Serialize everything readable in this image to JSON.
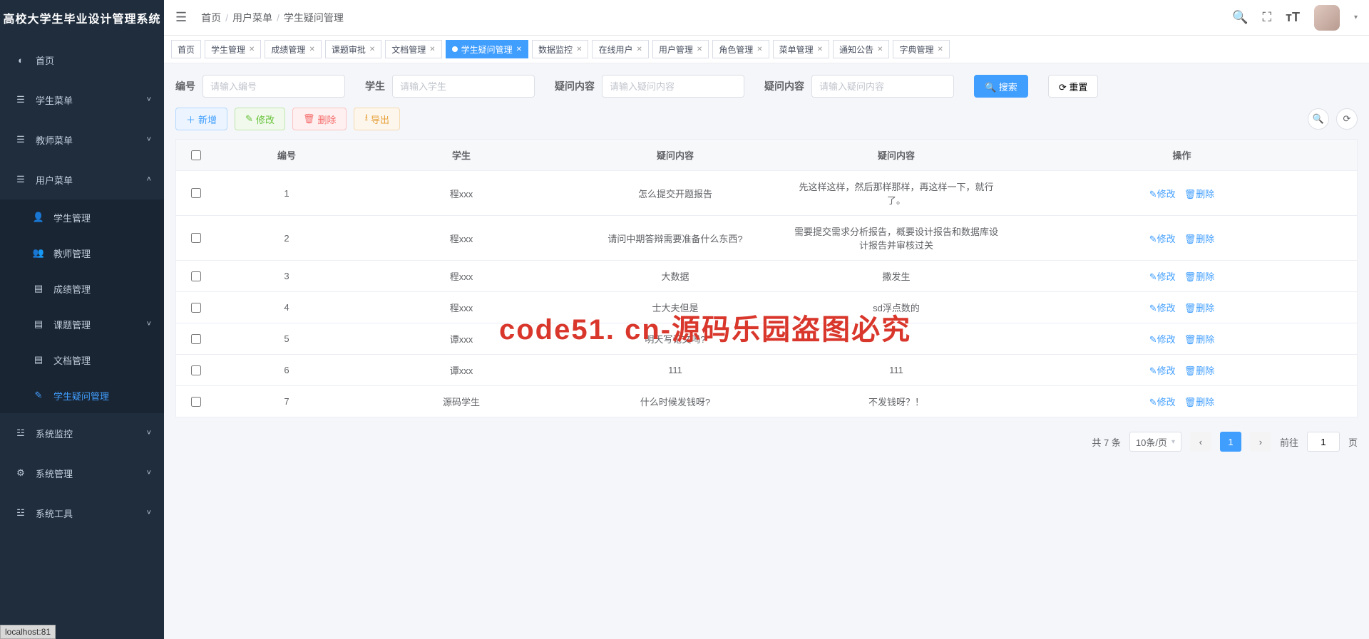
{
  "app_title": "高校大学生毕业设计管理系统",
  "breadcrumb": [
    "首页",
    "用户菜单",
    "学生疑问管理"
  ],
  "header_icons": {
    "search": "search-icon",
    "fullscreen": "fullscreen-icon",
    "fontsize": "fontsize-icon"
  },
  "sidebar": [
    {
      "icon": "◐",
      "label": "首页",
      "type": "item"
    },
    {
      "icon": "☰",
      "label": "学生菜单",
      "type": "group",
      "expand": "˅"
    },
    {
      "icon": "☰",
      "label": "教师菜单",
      "type": "group",
      "expand": "˅"
    },
    {
      "icon": "☰",
      "label": "用户菜单",
      "type": "group",
      "expand": "˄",
      "children": [
        {
          "icon": "👤",
          "label": "学生管理"
        },
        {
          "icon": "👥",
          "label": "教师管理"
        },
        {
          "icon": "▤",
          "label": "成绩管理"
        },
        {
          "icon": "▤",
          "label": "课题管理",
          "expand": "˅"
        },
        {
          "icon": "▤",
          "label": "文档管理"
        },
        {
          "icon": "✎",
          "label": "学生疑问管理",
          "active": true
        }
      ]
    },
    {
      "icon": "☳",
      "label": "系统监控",
      "type": "group",
      "expand": "˅"
    },
    {
      "icon": "⚙",
      "label": "系统管理",
      "type": "group",
      "expand": "˅"
    },
    {
      "icon": "☳",
      "label": "系统工具",
      "type": "group",
      "expand": "˅"
    }
  ],
  "tabs": [
    {
      "label": "首页",
      "nonclose": true
    },
    {
      "label": "学生管理"
    },
    {
      "label": "成绩管理"
    },
    {
      "label": "课题审批"
    },
    {
      "label": "文档管理"
    },
    {
      "label": "学生疑问管理",
      "active": true
    },
    {
      "label": "数据监控"
    },
    {
      "label": "在线用户"
    },
    {
      "label": "用户管理"
    },
    {
      "label": "角色管理"
    },
    {
      "label": "菜单管理"
    },
    {
      "label": "通知公告"
    },
    {
      "label": "字典管理"
    }
  ],
  "search": {
    "fields": [
      {
        "label": "编号",
        "placeholder": "请输入编号"
      },
      {
        "label": "学生",
        "placeholder": "请输入学生"
      },
      {
        "label": "疑问内容",
        "placeholder": "请输入疑问内容"
      },
      {
        "label": "疑问内容",
        "placeholder": "请输入疑问内容"
      }
    ],
    "search_btn": "搜索",
    "reset_btn": "重置"
  },
  "toolbar": {
    "add": "新增",
    "edit": "修改",
    "del": "删除",
    "export": "导出"
  },
  "table": {
    "headers": [
      "",
      "编号",
      "学生",
      "疑问内容",
      "疑问内容",
      "操作"
    ],
    "op_edit": "修改",
    "op_del": "删除",
    "rows": [
      {
        "id": "1",
        "stu": "程xxx",
        "q1": "怎么提交开题报告",
        "q2": "先这样这样，然后那样那样，再这样一下，就行了。"
      },
      {
        "id": "2",
        "stu": "程xxx",
        "q1": "请问中期答辩需要准备什么东西?",
        "q2": "需要提交需求分析报告，概要设计报告和数据库设计报告并审核过关"
      },
      {
        "id": "3",
        "stu": "程xxx",
        "q1": "大数据",
        "q2": "撒发生"
      },
      {
        "id": "4",
        "stu": "程xxx",
        "q1": "士大夫但是",
        "q2": "sd浮点数的"
      },
      {
        "id": "5",
        "stu": "谭xxx",
        "q1": "明天写论文吗?",
        "q2": ""
      },
      {
        "id": "6",
        "stu": "谭xxx",
        "q1": "111",
        "q2": "111"
      },
      {
        "id": "7",
        "stu": "源码学生",
        "q1": "什么时候发钱呀?",
        "q2": "不发钱呀？！"
      }
    ]
  },
  "pagination": {
    "total_text": "共 7 条",
    "page_size": "10条/页",
    "current": "1",
    "goto_pre": "前往",
    "goto_val": "1",
    "goto_suf": "页"
  },
  "watermark": "code51. cn-源码乐园盗图必究",
  "statusbar": "localhost:81"
}
